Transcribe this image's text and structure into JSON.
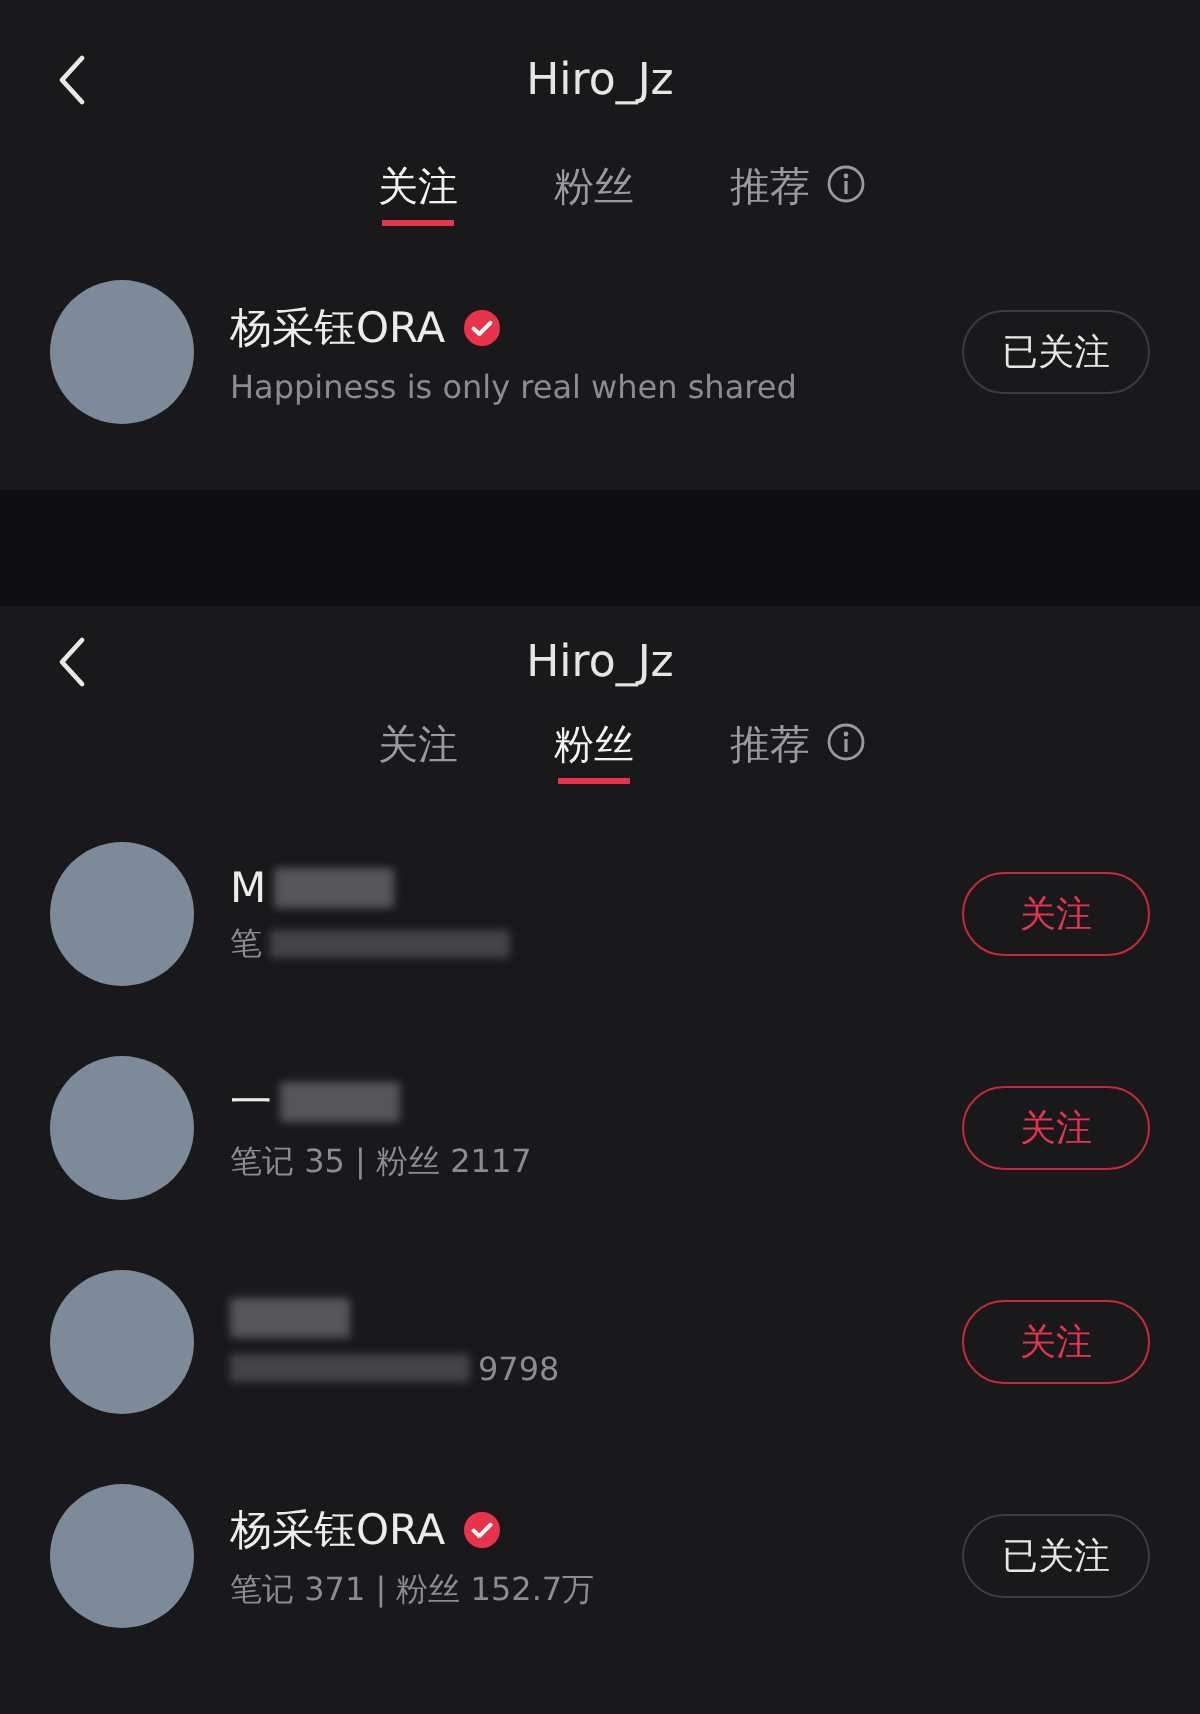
{
  "screens": [
    {
      "title": "Hiro_Jz",
      "tabs": [
        {
          "label": "关注",
          "selected": true,
          "info": false
        },
        {
          "label": "粉丝",
          "selected": false,
          "info": false
        },
        {
          "label": "推荐",
          "selected": false,
          "info": true
        }
      ],
      "users": [
        {
          "name": "杨采钰ORA",
          "verified": true,
          "subtitle": "Happiness is only real when shared",
          "name_blurred": false,
          "subtitle_blurred": false,
          "button": "已关注",
          "followed": true
        }
      ]
    },
    {
      "title": "Hiro_Jz",
      "tabs": [
        {
          "label": "关注",
          "selected": false,
          "info": false
        },
        {
          "label": "粉丝",
          "selected": true,
          "info": false
        },
        {
          "label": "推荐",
          "selected": false,
          "info": true
        }
      ],
      "users": [
        {
          "name": "M",
          "verified": false,
          "subtitle": "笔",
          "name_blurred": true,
          "subtitle_blurred": true,
          "button": "关注",
          "followed": false
        },
        {
          "name": "一",
          "verified": false,
          "subtitle": "笔记 35 | 粉丝 2117",
          "name_blurred": true,
          "subtitle_blurred": false,
          "button": "关注",
          "followed": false
        },
        {
          "verified": false,
          "subtitle_tail": "9798",
          "name_blurred": true,
          "subtitle_blurred": true,
          "button": "关注",
          "followed": false
        },
        {
          "name": "杨采钰ORA",
          "verified": true,
          "subtitle": "笔记 371 | 粉丝 152.7万",
          "name_blurred": false,
          "subtitle_blurred": false,
          "button": "已关注",
          "followed": true
        }
      ]
    }
  ]
}
